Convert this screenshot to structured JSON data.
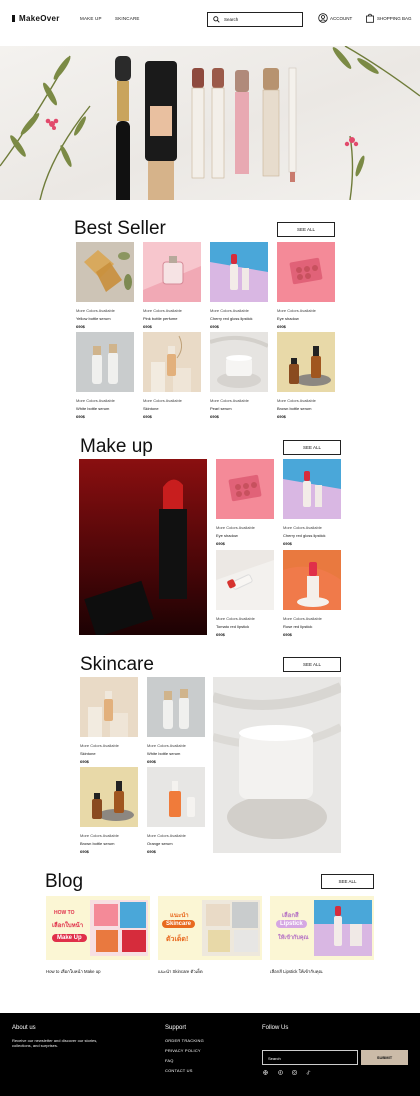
{
  "header": {
    "logo": "MakeOver",
    "nav": [
      "MAKE UP",
      "SKINCARE"
    ],
    "search_placeholder": "Search",
    "account_label": "ACCOUNT",
    "bag_label": "SHOPPING BAG"
  },
  "best_seller": {
    "title": "Best Seller",
    "see_all": "SEE ALL",
    "products": [
      {
        "more": "More Colors Available",
        "name": "Yellow bottle serum",
        "price": "690$"
      },
      {
        "more": "More Colors Available",
        "name": "Pink bottle perfume",
        "price": "690$"
      },
      {
        "more": "More Colors Available",
        "name": "Cherry red gloss lipstick",
        "price": "690$"
      },
      {
        "more": "More Colors Available",
        "name": "Eye shadow",
        "price": "690$"
      },
      {
        "more": "More Colors Available",
        "name": "White bottle serum",
        "price": "690$"
      },
      {
        "more": "More Colors Available",
        "name": "Skintone",
        "price": "690$"
      },
      {
        "more": "More Colors Available",
        "name": "Pearl serum",
        "price": "690$"
      },
      {
        "more": "More Colors Available",
        "name": "Brown bottle serum",
        "price": "690$"
      }
    ]
  },
  "makeup": {
    "title": "Make up",
    "see_all": "SEE ALL",
    "products": [
      {
        "more": "More Colors Available",
        "name": "Eye shadow",
        "price": "690$"
      },
      {
        "more": "More Colors Available",
        "name": "Cherry red gloss lipstick",
        "price": "690$"
      },
      {
        "more": "More Colors Available",
        "name": "Tomato red lipstick",
        "price": "690$"
      },
      {
        "more": "More Colors Available",
        "name": "Rose red lipstick",
        "price": "690$"
      }
    ]
  },
  "skincare": {
    "title": "Skincare",
    "see_all": "SEE ALL",
    "products": [
      {
        "more": "More Colors Available",
        "name": "Skintone",
        "price": "690$"
      },
      {
        "more": "More Colors Available",
        "name": "White bottle serum",
        "price": "690$"
      },
      {
        "more": "More Colors Available",
        "name": "Brown bottle serum",
        "price": "690$"
      },
      {
        "more": "More Colors Available",
        "name": "Orange serum",
        "price": "690$"
      }
    ]
  },
  "blog": {
    "title": "Blog",
    "see_all": "SEE ALL",
    "posts": [
      {
        "caption": "How to เลือกใบหน้า Make up",
        "art_line1": "HOW TO",
        "art_line2": "เลือกใบหน้า",
        "art_line3": "Make Up"
      },
      {
        "caption": "แนะนำ Skincare ตัวเด็ด",
        "art_line1": "แนะนำ",
        "art_line2": "Skincare",
        "art_line3": "ตัวเด็ด!"
      },
      {
        "caption": "เลือกสี Lipstick ให้เข้ากับคุณ",
        "art_line1": "เลือกสี",
        "art_line2": "Lipstick",
        "art_line3": "ให้เข้ากับคุณ"
      }
    ]
  },
  "footer": {
    "about_title": "About us",
    "about_text": "Receive our newsletter and discover our stories, collections, and surprises.",
    "support_title": "Support",
    "support_links": [
      "ORDER TRACKING",
      "PRIVACY POLICY",
      "FAQ",
      "CONTACT US"
    ],
    "follow_title": "Follow Us",
    "email_placeholder": "Search",
    "submit_label": "SUBMIT",
    "social_icons": [
      "globe-icon",
      "facebook-icon",
      "instagram-icon",
      "tiktok-icon"
    ]
  },
  "colors": {
    "accent_submit": "#cbbba8",
    "footer_bg": "#000000",
    "blog_bg": "#fbf6d4"
  }
}
